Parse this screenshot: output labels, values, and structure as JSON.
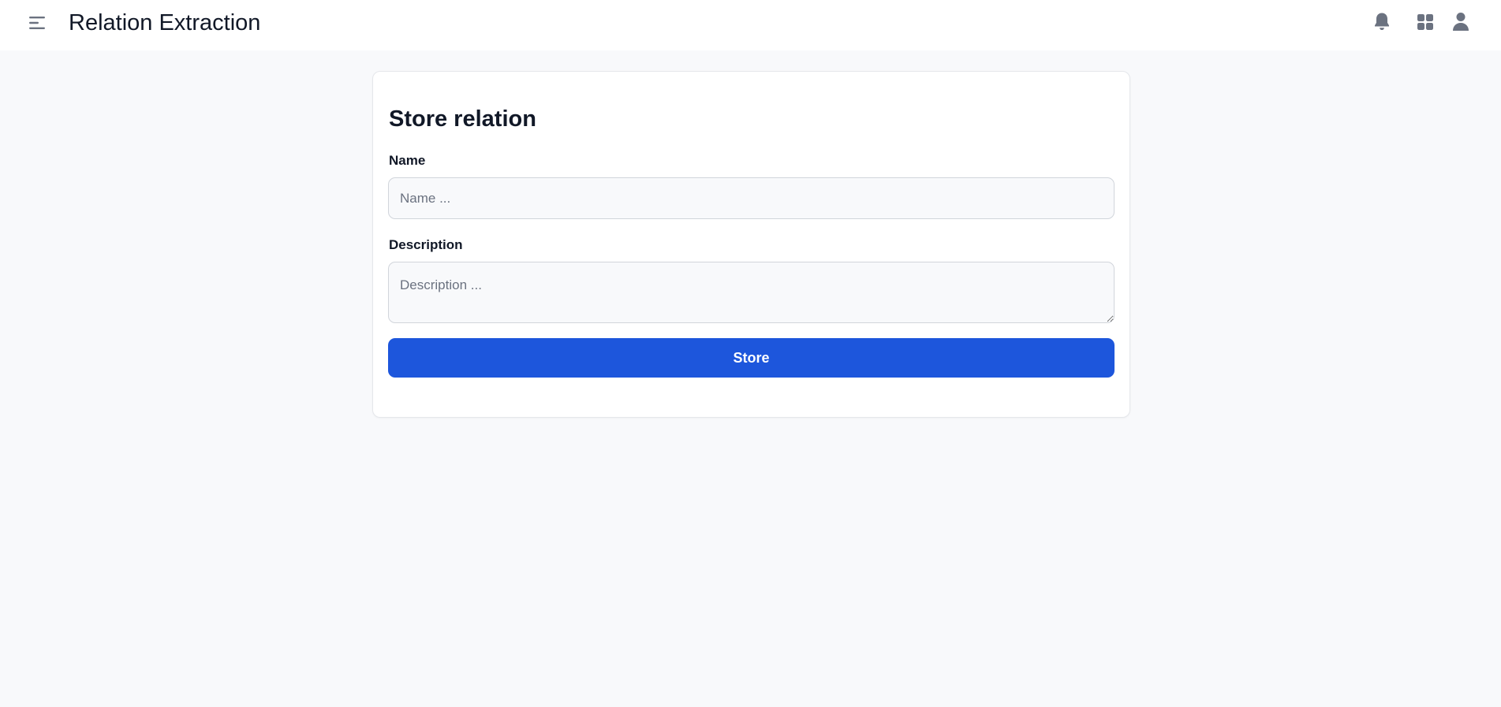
{
  "header": {
    "title": "Relation Extraction",
    "icons": {
      "menu": "menu-icon",
      "notifications": "bell-icon",
      "apps": "grid-icon",
      "profile": "user-icon"
    },
    "icon_color": "#6b7280"
  },
  "form": {
    "title": "Store relation",
    "name_label": "Name",
    "name_value": "",
    "name_placeholder": "Name ...",
    "description_label": "Description",
    "description_value": "",
    "description_placeholder": "Description ...",
    "submit_label": "Store"
  },
  "colors": {
    "background": "#f8f9fb",
    "card": "#ffffff",
    "primary": "#1d56dc",
    "text": "#111827"
  }
}
